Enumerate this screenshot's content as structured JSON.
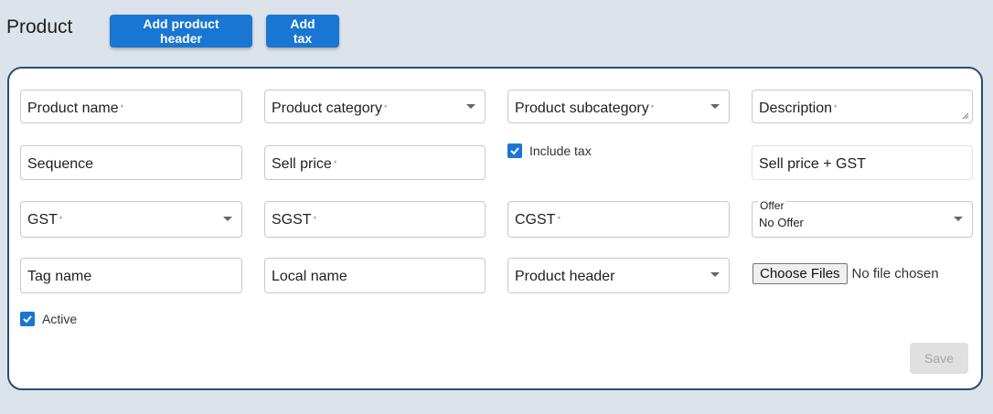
{
  "header": {
    "title": "Product",
    "add_header_label": "Add product header",
    "add_tax_label": "Add tax"
  },
  "form": {
    "product_name": "Product name",
    "product_category": "Product category",
    "product_subcategory": "Product subcategory",
    "description": "Description",
    "sequence": "Sequence",
    "sell_price": "Sell price",
    "include_tax": "Include tax",
    "sell_price_gst": "Sell price + GST",
    "gst": "GST",
    "sgst": "SGST",
    "cgst": "CGST",
    "offer_label": "Offer",
    "offer_value": "No Offer",
    "tag_name": "Tag name",
    "local_name": "Local name",
    "product_header": "Product header",
    "choose_files": "Choose Files",
    "file_status": "No file chosen",
    "active": "Active",
    "required_mark": "*",
    "save_label": "Save"
  },
  "colors": {
    "primary": "#1976d2",
    "card_border": "#2c4c74",
    "background": "#dde3ea"
  }
}
